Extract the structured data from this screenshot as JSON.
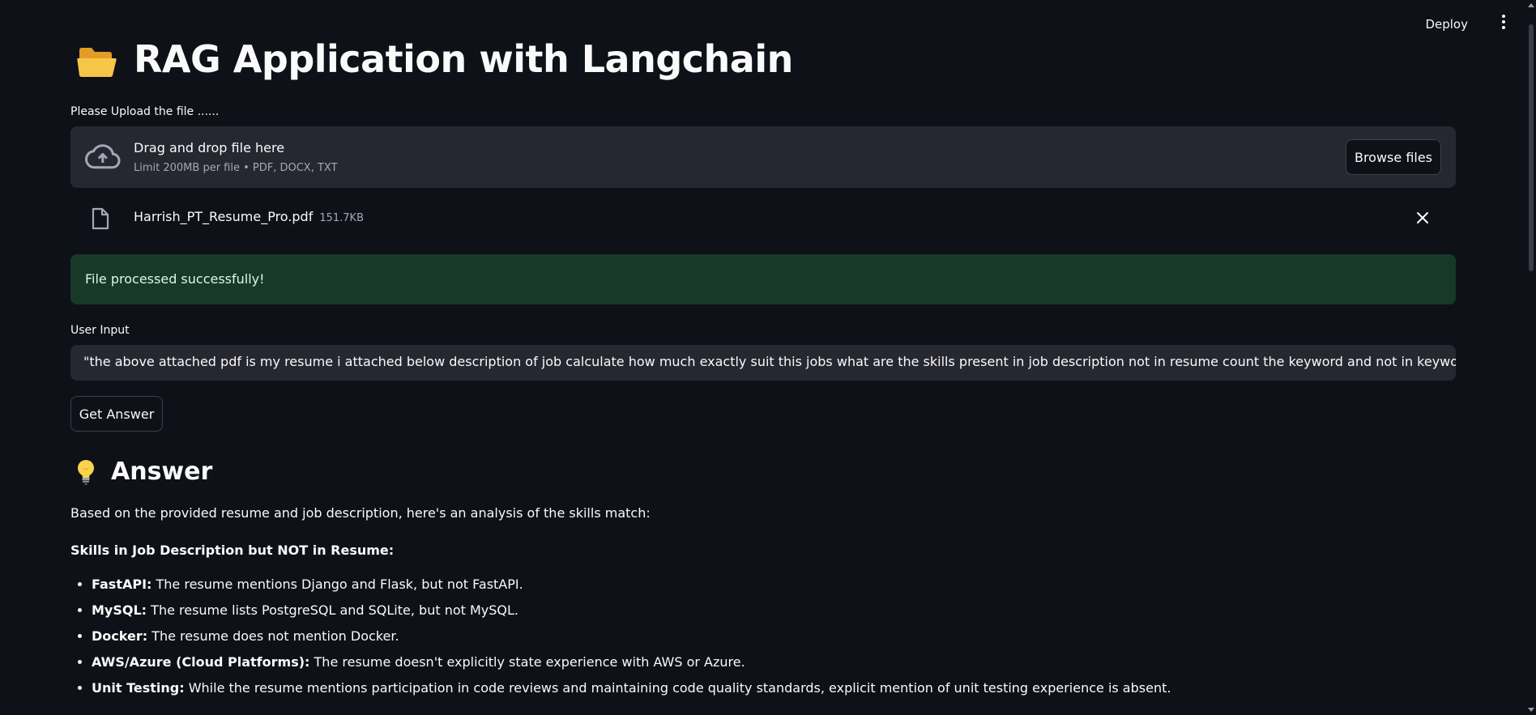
{
  "header": {
    "deploy_label": "Deploy",
    "menu_icon": "kebab-menu-icon"
  },
  "title": {
    "icon": "folder-icon",
    "text": "RAG Application with Langchain"
  },
  "upload": {
    "label": "Please Upload the file ......",
    "dropzone_title": "Drag and drop file here",
    "dropzone_sub": "Limit 200MB per file • PDF, DOCX, TXT",
    "browse_label": "Browse files",
    "file": {
      "name": "Harrish_PT_Resume_Pro.pdf",
      "size": "151.7KB"
    }
  },
  "status": {
    "success_text": "File processed successfully!",
    "success_bg": "#173928"
  },
  "user_input": {
    "label": "User Input",
    "value": "\"the above attached pdf is my resume i attached below description of job calculate how much exactly suit this jobs what are the skills present in job description not in resume count the keyword and not in keyword counts calcul"
  },
  "actions": {
    "get_answer_label": "Get Answer"
  },
  "answer": {
    "heading": "Answer",
    "icon": "lightbulb-icon",
    "intro": "Based on the provided resume and job description, here's an analysis of the skills match:",
    "subheading": "Skills in Job Description but NOT in Resume:",
    "items": [
      {
        "term": "FastAPI:",
        "text": " The resume mentions Django and Flask, but not FastAPI."
      },
      {
        "term": "MySQL:",
        "text": " The resume lists PostgreSQL and SQLite, but not MySQL."
      },
      {
        "term": "Docker:",
        "text": " The resume does not mention Docker."
      },
      {
        "term": "AWS/Azure (Cloud Platforms):",
        "text": " The resume doesn't explicitly state experience with AWS or Azure."
      },
      {
        "term": "Unit Testing:",
        "text": " While the resume mentions participation in code reviews and maintaining code quality standards, explicit mention of unit testing experience is absent."
      }
    ]
  },
  "colors": {
    "background": "#0e1117",
    "panel": "#262730",
    "text": "#fafafa",
    "muted": "#a3a8b8"
  }
}
